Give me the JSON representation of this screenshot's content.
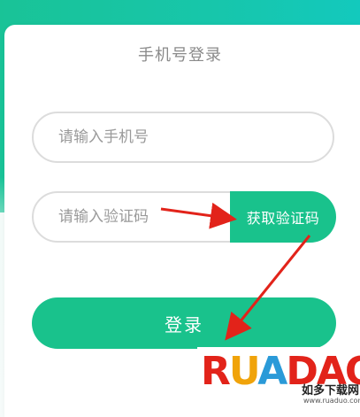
{
  "login": {
    "title": "手机号登录",
    "phone_placeholder": "请输入手机号",
    "code_placeholder": "请输入验证码",
    "get_code_label": "获取验证码",
    "login_label": "登录"
  },
  "watermark": {
    "logo_text": "RUADAO",
    "cn_text": "如多下载网",
    "url": "www.ruaduo.com"
  },
  "colors": {
    "accent": "#19c28c",
    "header_gradient_start": "#19c397",
    "header_gradient_end": "#13c9bd",
    "annotation_arrow": "#e2231a"
  }
}
